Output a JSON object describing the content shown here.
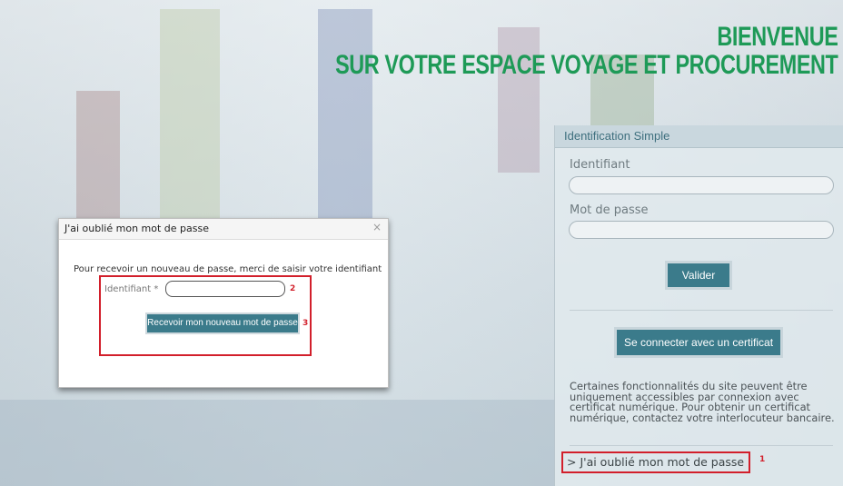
{
  "hero": {
    "line1": "BIENVENUE",
    "line2": "SUR VOTRE ESPACE VOYAGE ET PROCUREMENT"
  },
  "login": {
    "header": "Identification Simple",
    "identifiant_label": "Identifiant",
    "identifiant_value": "",
    "password_label": "Mot de passe",
    "password_value": "",
    "validate_button": "Valider",
    "certificate_button": "Se connecter avec un certificat",
    "info_text": "Certaines fonctionnalités du site peuvent être uniquement accessibles par connexion avec certificat numérique. Pour obtenir un certificat numérique, contactez votre interlocuteur bancaire.",
    "forgot_link": "> J'ai oublié mon mot de passe"
  },
  "modal": {
    "title": "J'ai oublié mon mot de passe",
    "close": "×",
    "instructions": "Pour recevoir un nouveau de passe, merci de saisir votre identifiant",
    "identifiant_label": "Identifiant *",
    "identifiant_value": "",
    "submit_button": "Recevoir mon nouveau mot de passe"
  },
  "annotations": [
    "1",
    "2",
    "3"
  ],
  "colors": {
    "accent_green": "#1e9a57",
    "button_teal": "#3b7b8b",
    "annotation_red": "#d21f2b"
  }
}
